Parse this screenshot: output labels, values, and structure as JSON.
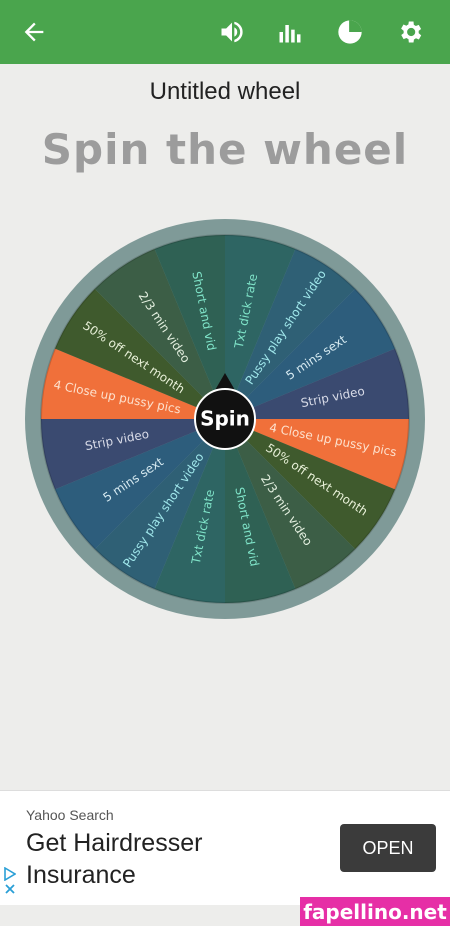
{
  "topbar": {
    "back_icon": "arrow-left-icon",
    "sound_icon": "volume-icon",
    "stats_icon": "bar-chart-icon",
    "pie_icon": "pie-chart-icon",
    "settings_icon": "gear-icon",
    "bg_color": "#4aa54d"
  },
  "wheel_title": "Untitled wheel",
  "heading": "Spin the wheel",
  "wheel": {
    "center_label": "Spin",
    "segments": [
      {
        "label": "Txt dick rate",
        "color": "#2e6563",
        "text_color": "#7fe3c8"
      },
      {
        "label": "Pussy play short video",
        "color": "#2f6075",
        "text_color": "#9fe6ea"
      },
      {
        "label": "5 mins sext",
        "color": "#2d5d7c",
        "text_color": "#d6eaf1"
      },
      {
        "label": "Strip video",
        "color": "#3a4a70",
        "text_color": "#d9dce8"
      },
      {
        "label": "4 Close up pussy pics",
        "color": "#f0703a",
        "text_color": "#fde0cc"
      },
      {
        "label": "50% off next month",
        "color": "#3f5a2d",
        "text_color": "#e8f0d8"
      },
      {
        "label": "2/3 min video",
        "color": "#3c5e46",
        "text_color": "#e4f0e0"
      },
      {
        "label": "Short and vid",
        "color": "#2f6154",
        "text_color": "#7fe3c8"
      },
      {
        "label": "Txt dick rate",
        "color": "#2e6563",
        "text_color": "#7fe3c8"
      },
      {
        "label": "Pussy play short video",
        "color": "#2f6075",
        "text_color": "#9fe6ea"
      },
      {
        "label": "5 mins sext",
        "color": "#2d5d7c",
        "text_color": "#d6eaf1"
      },
      {
        "label": "Strip video",
        "color": "#3a4a70",
        "text_color": "#d9dce8"
      },
      {
        "label": "4 Close up pussy pics",
        "color": "#f0703a",
        "text_color": "#fde0cc"
      },
      {
        "label": "50% off next month",
        "color": "#3f5a2d",
        "text_color": "#e8f0d8"
      },
      {
        "label": "2/3 min video",
        "color": "#3c5e46",
        "text_color": "#e4f0e0"
      },
      {
        "label": "Short and vid",
        "color": "#2f6154",
        "text_color": "#7fe3c8"
      }
    ]
  },
  "ad": {
    "source": "Yahoo Search",
    "headline": "Get Hairdresser Insurance",
    "button": "OPEN"
  },
  "watermark": "fapellino.net"
}
